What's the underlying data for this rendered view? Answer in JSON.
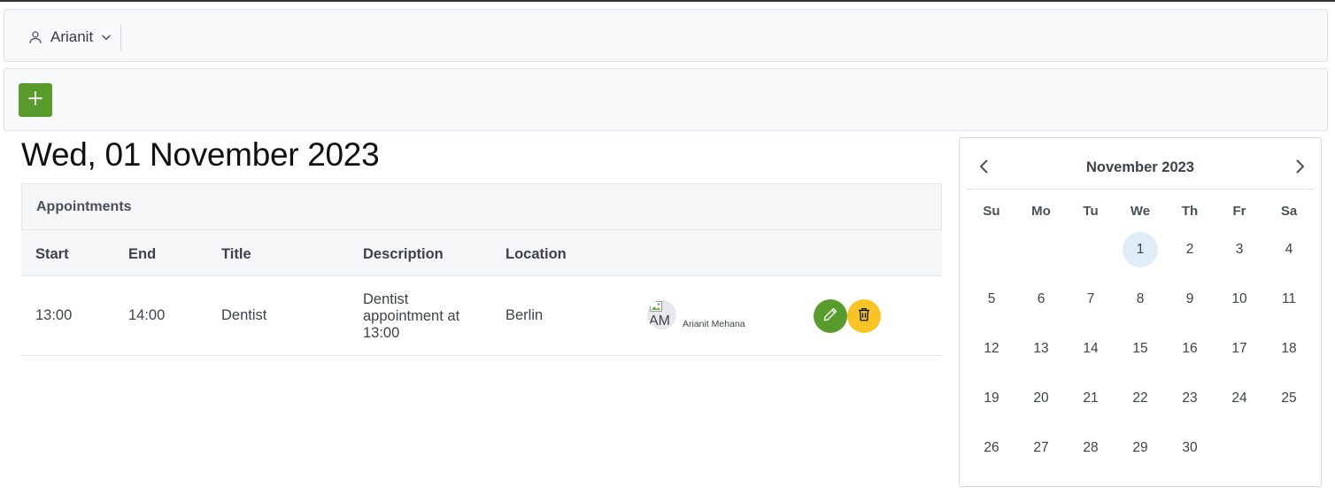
{
  "navbar": {
    "user_name": "Arianit"
  },
  "page": {
    "title": "Wed, 01 November 2023"
  },
  "appointments": {
    "header": "Appointments",
    "columns": [
      "Start",
      "End",
      "Title",
      "Description",
      "Location"
    ],
    "rows": [
      {
        "start": "13:00",
        "end": "14:00",
        "title": "Dentist",
        "description": "Dentist appointment at 13:00",
        "location": "Berlin",
        "avatar_initials": "AM",
        "owner": "Arianit Mehana"
      }
    ]
  },
  "calendar": {
    "title": "November 2023",
    "weekdays": [
      "Su",
      "Mo",
      "Tu",
      "We",
      "Th",
      "Fr",
      "Sa"
    ],
    "first_weekday_index": 3,
    "days_in_month": 30,
    "selected_day": 1
  },
  "colors": {
    "primary_green": "#5a9b2e",
    "warning_yellow": "#f7c325",
    "selected_day_bg": "#e0edf9"
  },
  "icons": {
    "user": "user-icon",
    "dropdown": "chevron-down-icon",
    "add": "plus-icon",
    "edit": "pencil-icon",
    "delete": "trash-icon",
    "prev": "chevron-left-icon",
    "next": "chevron-right-icon"
  }
}
